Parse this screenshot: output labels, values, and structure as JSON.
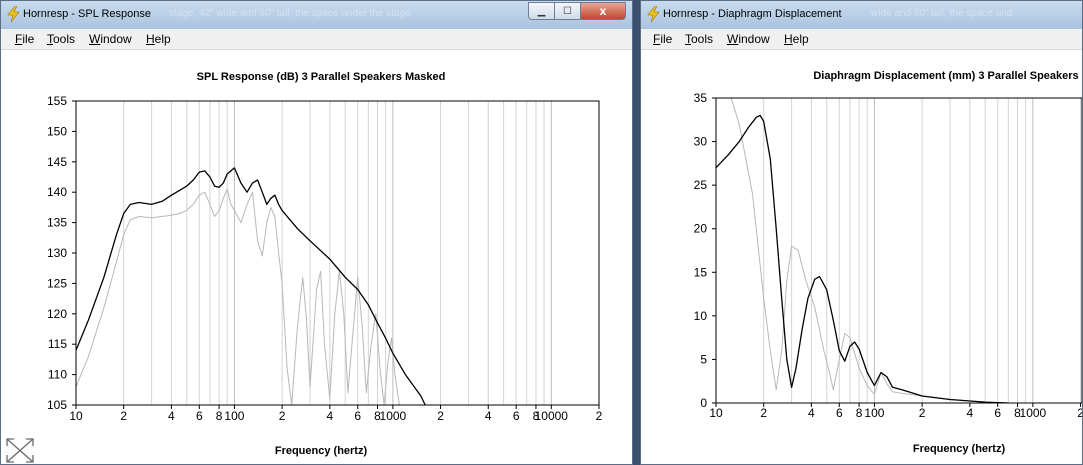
{
  "left_window": {
    "title": "Hornresp - SPL Response",
    "ghost_title": "stage, 42\" wide and 60\" tall, the space under the stage",
    "menu": [
      {
        "key": "F",
        "rest": "ile"
      },
      {
        "key": "T",
        "rest": "ools"
      },
      {
        "key": "W",
        "rest": "indow"
      },
      {
        "key": "H",
        "rest": "elp"
      }
    ],
    "close_glyph": "x"
  },
  "right_window": {
    "title": "Hornresp - Diaphragm Displacement",
    "ghost_title": "wide and 60\" tall, the space und",
    "menu": [
      {
        "key": "F",
        "rest": "ile"
      },
      {
        "key": "T",
        "rest": "ools"
      },
      {
        "key": "W",
        "rest": "indow"
      },
      {
        "key": "H",
        "rest": "elp"
      }
    ]
  },
  "icons": {
    "app": "lightning-bolt-icon",
    "resize": "resize-arrows-icon"
  },
  "colors": {
    "primary_trace": "#000000",
    "secondary_trace": "#b8b8b8",
    "grid": "#d4d4d4",
    "titlebar": "#b9cfe6",
    "close_button": "#c7432a"
  },
  "chart_data": [
    {
      "type": "line",
      "title": "SPL Response (dB)   3 Parallel Speakers   Masked",
      "xlabel": "Frequency (hertz)",
      "ylabel": "",
      "xscale": "log",
      "xlim": [
        10,
        20000
      ],
      "ylim": [
        105,
        155
      ],
      "yticks": [
        "155",
        "150",
        "145",
        "140",
        "135",
        "130",
        "125",
        "120",
        "115",
        "110",
        "105"
      ],
      "xtick_labels": [
        {
          "f": 10,
          "label": "10"
        },
        {
          "f": 20,
          "label": "2"
        },
        {
          "f": 40,
          "label": "4"
        },
        {
          "f": 60,
          "label": "6"
        },
        {
          "f": 80,
          "label": "8"
        },
        {
          "f": 100,
          "label": "100"
        },
        {
          "f": 200,
          "label": "2"
        },
        {
          "f": 400,
          "label": "4"
        },
        {
          "f": 600,
          "label": "6"
        },
        {
          "f": 800,
          "label": "8"
        },
        {
          "f": 1000,
          "label": "1000"
        },
        {
          "f": 2000,
          "label": "2"
        },
        {
          "f": 4000,
          "label": "4"
        },
        {
          "f": 6000,
          "label": "6"
        },
        {
          "f": 8000,
          "label": "8"
        },
        {
          "f": 10000,
          "label": "10000"
        },
        {
          "f": 20000,
          "label": "2"
        }
      ],
      "grid": true,
      "series": [
        {
          "style": "primary",
          "points": [
            [
              10,
              114
            ],
            [
              12,
              119
            ],
            [
              15,
              126
            ],
            [
              18,
              133
            ],
            [
              20,
              136.5
            ],
            [
              22,
              138
            ],
            [
              25,
              138.3
            ],
            [
              30,
              138
            ],
            [
              35,
              138.5
            ],
            [
              40,
              139.5
            ],
            [
              45,
              140.3
            ],
            [
              50,
              141
            ],
            [
              55,
              142
            ],
            [
              60,
              143.3
            ],
            [
              65,
              143.5
            ],
            [
              70,
              142.5
            ],
            [
              75,
              141
            ],
            [
              80,
              140.8
            ],
            [
              85,
              141.5
            ],
            [
              90,
              143
            ],
            [
              100,
              144
            ],
            [
              110,
              141.5
            ],
            [
              120,
              140
            ],
            [
              130,
              141.5
            ],
            [
              140,
              142
            ],
            [
              150,
              140
            ],
            [
              160,
              138
            ],
            [
              170,
              139
            ],
            [
              180,
              139.5
            ],
            [
              190,
              138
            ],
            [
              200,
              137
            ],
            [
              250,
              134
            ],
            [
              300,
              132
            ],
            [
              400,
              129
            ],
            [
              500,
              126
            ],
            [
              600,
              124
            ],
            [
              700,
              121.5
            ],
            [
              800,
              118.5
            ],
            [
              900,
              116
            ],
            [
              1000,
              113.5
            ],
            [
              1200,
              110
            ],
            [
              1500,
              106.5
            ],
            [
              1600,
              105
            ]
          ]
        },
        {
          "style": "secondary",
          "points": [
            [
              10,
              108
            ],
            [
              12,
              113
            ],
            [
              15,
              121
            ],
            [
              18,
              128.5
            ],
            [
              20,
              133
            ],
            [
              22,
              135.5
            ],
            [
              25,
              136
            ],
            [
              30,
              135.8
            ],
            [
              35,
              136
            ],
            [
              40,
              136.2
            ],
            [
              45,
              136.5
            ],
            [
              50,
              137
            ],
            [
              55,
              138
            ],
            [
              60,
              139.5
            ],
            [
              65,
              140
            ],
            [
              70,
              138
            ],
            [
              75,
              136
            ],
            [
              80,
              137
            ],
            [
              85,
              139
            ],
            [
              90,
              140.5
            ],
            [
              95,
              138
            ],
            [
              100,
              137
            ],
            [
              110,
              135
            ],
            [
              120,
              138
            ],
            [
              130,
              140
            ],
            [
              140,
              132
            ],
            [
              150,
              129.5
            ],
            [
              160,
              135
            ],
            [
              170,
              137.5
            ],
            [
              180,
              136
            ],
            [
              190,
              130
            ],
            [
              200,
              125
            ],
            [
              215,
              111
            ],
            [
              230,
              105
            ],
            [
              250,
              118
            ],
            [
              270,
              126
            ],
            [
              285,
              119
            ],
            [
              300,
              108
            ],
            [
              330,
              124
            ],
            [
              350,
              127
            ],
            [
              370,
              115
            ],
            [
              400,
              106
            ],
            [
              430,
              120
            ],
            [
              460,
              127
            ],
            [
              490,
              120
            ],
            [
              520,
              107
            ],
            [
              560,
              117
            ],
            [
              600,
              126
            ],
            [
              640,
              118
            ],
            [
              680,
              107
            ],
            [
              730,
              115
            ],
            [
              780,
              120
            ],
            [
              830,
              111
            ],
            [
              880,
              105
            ],
            [
              930,
              112
            ],
            [
              980,
              116
            ],
            [
              1030,
              110
            ],
            [
              1100,
              105
            ]
          ]
        }
      ]
    },
    {
      "type": "line",
      "title": "Diaphragm Displacement (mm)   3 Parallel Speakers",
      "xlabel": "Frequency (hertz)",
      "ylabel": "",
      "xscale": "log",
      "xlim": [
        10,
        20000
      ],
      "ylim": [
        0,
        35
      ],
      "yticks": [
        "35",
        "30",
        "25",
        "20",
        "15",
        "10",
        "5",
        "0"
      ],
      "xtick_labels": [
        {
          "f": 10,
          "label": "10"
        },
        {
          "f": 20,
          "label": "2"
        },
        {
          "f": 40,
          "label": "4"
        },
        {
          "f": 60,
          "label": "6"
        },
        {
          "f": 80,
          "label": "8"
        },
        {
          "f": 100,
          "label": "100"
        },
        {
          "f": 200,
          "label": "2"
        },
        {
          "f": 400,
          "label": "4"
        },
        {
          "f": 600,
          "label": "6"
        },
        {
          "f": 800,
          "label": "8"
        },
        {
          "f": 1000,
          "label": "1000"
        },
        {
          "f": 2000,
          "label": "2"
        }
      ],
      "grid": true,
      "series": [
        {
          "style": "primary",
          "points": [
            [
              10,
              27
            ],
            [
              12,
              28.5
            ],
            [
              14,
              30
            ],
            [
              16,
              31.6
            ],
            [
              18,
              32.8
            ],
            [
              19,
              33
            ],
            [
              20,
              32.3
            ],
            [
              22,
              28
            ],
            [
              24,
              20
            ],
            [
              26,
              12
            ],
            [
              28,
              5
            ],
            [
              30,
              1.8
            ],
            [
              32,
              4
            ],
            [
              35,
              8.5
            ],
            [
              38,
              12
            ],
            [
              42,
              14.2
            ],
            [
              45,
              14.5
            ],
            [
              50,
              13
            ],
            [
              55,
              9.5
            ],
            [
              60,
              6
            ],
            [
              65,
              4.8
            ],
            [
              70,
              6.5
            ],
            [
              75,
              7
            ],
            [
              80,
              6.2
            ],
            [
              90,
              3.5
            ],
            [
              100,
              2
            ],
            [
              110,
              3.5
            ],
            [
              120,
              3
            ],
            [
              130,
              1.8
            ],
            [
              150,
              1.5
            ],
            [
              170,
              1.2
            ],
            [
              200,
              0.8
            ],
            [
              300,
              0.4
            ],
            [
              500,
              0.1
            ],
            [
              700,
              0
            ]
          ]
        },
        {
          "style": "secondary",
          "points": [
            [
              12,
              36
            ],
            [
              14,
              32
            ],
            [
              17,
              24
            ],
            [
              20,
              12
            ],
            [
              22,
              6
            ],
            [
              24,
              1.5
            ],
            [
              26,
              6
            ],
            [
              28,
              14
            ],
            [
              30,
              18
            ],
            [
              33,
              17.5
            ],
            [
              37,
              14
            ],
            [
              42,
              11
            ],
            [
              48,
              6
            ],
            [
              52,
              3.5
            ],
            [
              55,
              1.5
            ],
            [
              60,
              5
            ],
            [
              65,
              8
            ],
            [
              70,
              7.5
            ],
            [
              80,
              4
            ],
            [
              90,
              2
            ],
            [
              100,
              1
            ],
            [
              110,
              3.5
            ],
            [
              120,
              2.2
            ],
            [
              130,
              1.3
            ],
            [
              150,
              1.1
            ],
            [
              200,
              0.8
            ],
            [
              300,
              0.4
            ],
            [
              500,
              0.1
            ],
            [
              700,
              0
            ]
          ]
        }
      ]
    }
  ]
}
